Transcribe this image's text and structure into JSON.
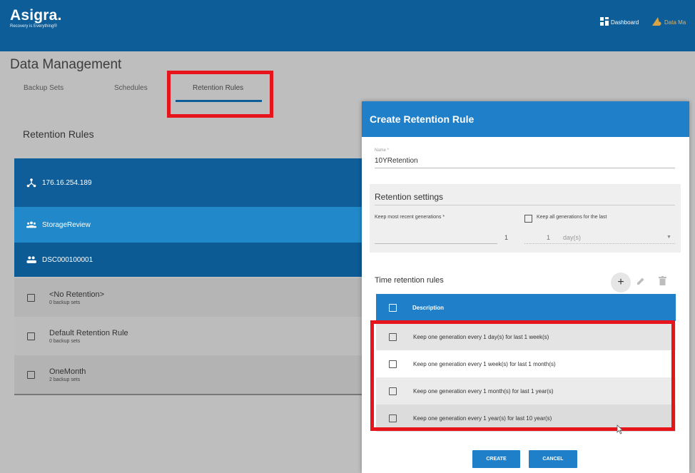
{
  "header": {
    "brand_name": "Asigra.",
    "brand_tagline": "Recovery is Everything®",
    "dashboard_label": "Dashboard",
    "data_management_label": "Data Ma"
  },
  "page": {
    "title": "Data Management",
    "tabs": [
      {
        "label": "Backup Sets"
      },
      {
        "label": "Schedules"
      },
      {
        "label": "Retention Rules",
        "active": true
      }
    ],
    "section_title": "Retention Rules"
  },
  "tree": {
    "server": "176.16.254.189",
    "client": "StorageReview",
    "account": "DSC000100001",
    "rules": [
      {
        "name": "<No Retention>",
        "sub": "0 backup sets"
      },
      {
        "name": "Default Retention Rule",
        "sub": "0 backup sets"
      },
      {
        "name": "OneMonth",
        "sub": "2 backup sets"
      }
    ]
  },
  "modal": {
    "title": "Create Retention Rule",
    "name_label": "Name *",
    "name_value": "10YRetention",
    "settings_title": "Retention settings",
    "keep_recent_label": "Keep most recent generations *",
    "keep_recent_value": "1",
    "keep_all_label": "Keep all generations for the last",
    "keep_all_value": "1",
    "keep_all_unit": "day(s)",
    "time_rules_title": "Time retention rules",
    "table_header": "Description",
    "time_rules": [
      "Keep one generation every 1 day(s) for last 1 week(s)",
      "Keep one generation every 1 week(s) for last 1 month(s)",
      "Keep one generation every 1 month(s) for last 1 year(s)",
      "Keep one generation every 1 year(s) for last 10 year(s)"
    ],
    "create_label": "CREATE",
    "cancel_label": "CANCEL"
  },
  "colors": {
    "header_blue": "#0d5d98",
    "modal_blue": "#1f7fc8",
    "highlight_red": "#e8141c"
  }
}
